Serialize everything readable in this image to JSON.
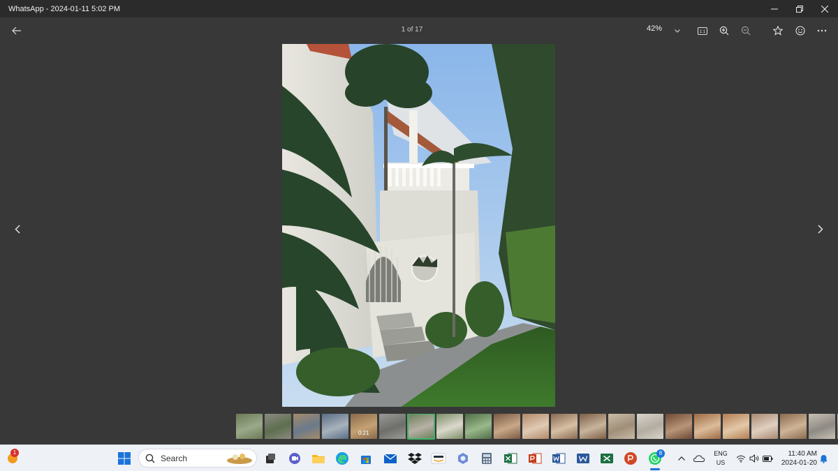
{
  "window": {
    "title": "WhatsApp - 2024-01-11 5:02 PM"
  },
  "toolbar": {
    "counter": "1 of 17",
    "zoom": "42%"
  },
  "filmstrip": {
    "active_index": 6,
    "video_duration": "0:21",
    "thumbs": [
      {
        "c1": "#6c7a55",
        "c2": "#9aa98a"
      },
      {
        "c1": "#8a8a80",
        "c2": "#5e6e4e"
      },
      {
        "c1": "#a48a6a",
        "c2": "#6a7a8a"
      },
      {
        "c1": "#5a6e86",
        "c2": "#a8b2bc"
      },
      {
        "c1": "#8a6a4a",
        "c2": "#c4a274"
      },
      {
        "c1": "#9a9a98",
        "c2": "#6e6e6a"
      },
      {
        "c1": "#6a7e58",
        "c2": "#b8b0a6"
      },
      {
        "c1": "#7a8e66",
        "c2": "#dcd8cc"
      },
      {
        "c1": "#4e6e48",
        "c2": "#9ab88a"
      },
      {
        "c1": "#7a5a44",
        "c2": "#c8a888"
      },
      {
        "c1": "#b28a6a",
        "c2": "#e0cab4"
      },
      {
        "c1": "#8a6a52",
        "c2": "#d6c0a4"
      },
      {
        "c1": "#7e5e46",
        "c2": "#c8b49c"
      },
      {
        "c1": "#c8bca8",
        "c2": "#a08e78"
      },
      {
        "c1": "#d8d4cc",
        "c2": "#b4aca0"
      },
      {
        "c1": "#6e4a36",
        "c2": "#b89478"
      },
      {
        "c1": "#9e6a44",
        "c2": "#dcbc9a"
      },
      {
        "c1": "#b47e54",
        "c2": "#e2c8a8"
      },
      {
        "c1": "#a88a72",
        "c2": "#e0cfc0"
      },
      {
        "c1": "#8a6a50",
        "c2": "#cfb497"
      },
      {
        "c1": "#c8c0b4",
        "c2": "#8e8a84"
      },
      {
        "c1": "#d6d0c8",
        "c2": "#a08870"
      },
      {
        "c1": "#b09a80",
        "c2": "#e8e0d4"
      }
    ]
  },
  "taskbar": {
    "widget_badge": "1",
    "search_label": "Search",
    "whatsapp_badge": "8",
    "lang_1": "ENG",
    "lang_2": "US",
    "time": "11:40 AM",
    "date": "2024-01-20"
  },
  "colors": {
    "background": "#383838",
    "titlebar": "#2b2b2b",
    "active_thumb_outline": "#3fb56a",
    "taskbar": "#eef2f7"
  }
}
